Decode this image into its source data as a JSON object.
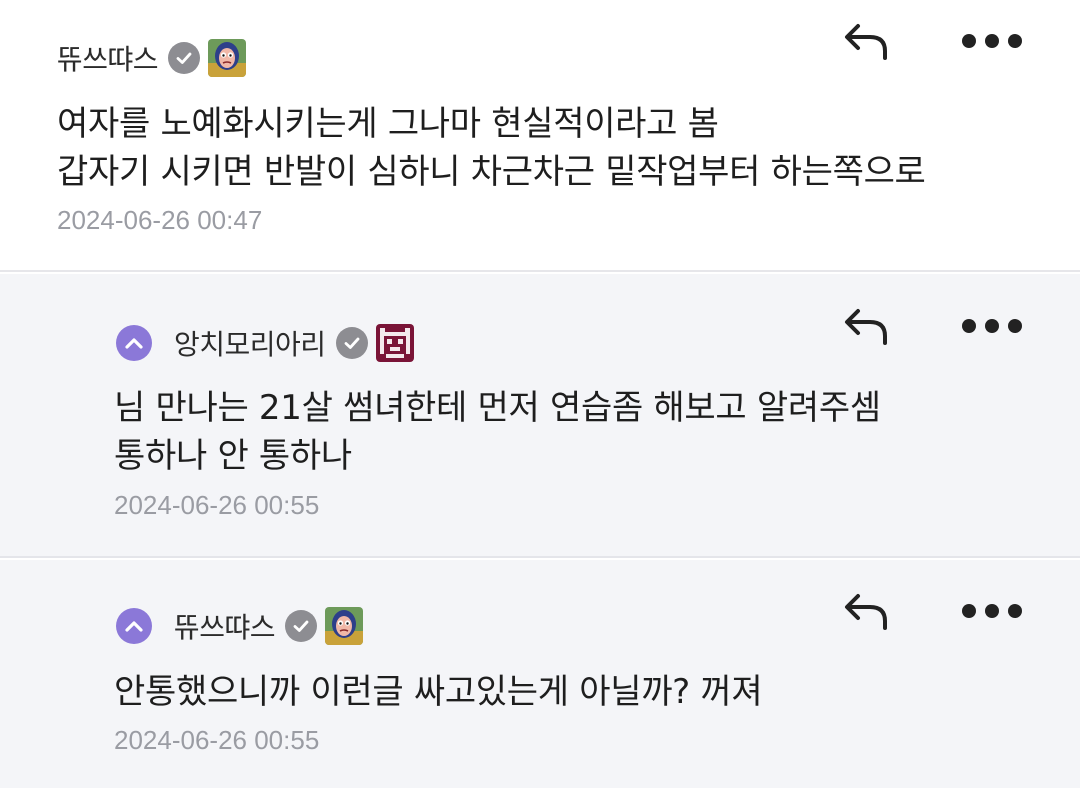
{
  "comments": [
    {
      "username": "뜌쓰땨스",
      "lines": [
        "여자를 노예화시키는게 그나마 현실적이라고 봄",
        "갑자기 시키면 반발이 심하니 차근차근 밑작업부터 하는쪽으로"
      ],
      "timestamp": "2024-06-26 00:47",
      "avatar_icon": "character-avatar-icon"
    },
    {
      "username": "앙치모리아리",
      "lines": [
        "님 만나는 21살 썸녀한테 먼저 연습좀 해보고 알려주셈",
        "통하나 안 통하나"
      ],
      "timestamp": "2024-06-26 00:55",
      "avatar_icon": "pixel-invader-avatar-icon"
    },
    {
      "username": "뜌쓰땨스",
      "lines": [
        "안통했으니까 이런글 싸고있는게 아닐까? 꺼져"
      ],
      "timestamp": "2024-06-26 00:55",
      "avatar_icon": "character-avatar-icon"
    }
  ],
  "colors": {
    "accent": "#8b78d8",
    "verified": "#8d8d92",
    "reply_background": "#f4f5f8",
    "timestamp": "#9a9ca3"
  }
}
